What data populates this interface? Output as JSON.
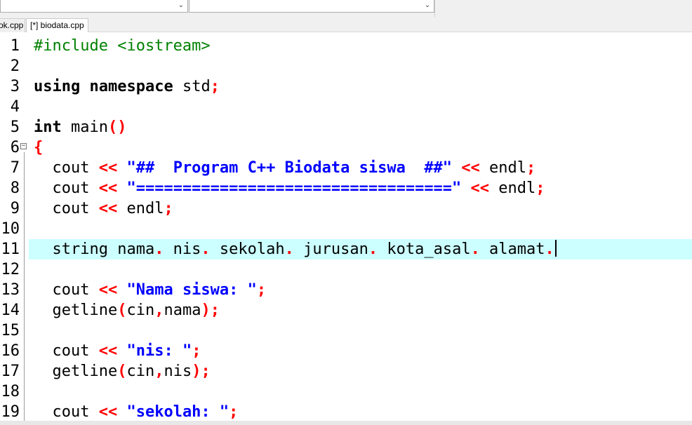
{
  "toolbar": {
    "combo1_value": "",
    "combo2_value": "",
    "dropdown_glyph": "⌄"
  },
  "tabs": [
    {
      "label": "ok.cpp",
      "active": false
    },
    {
      "label": "[*] biodata.cpp",
      "active": true
    }
  ],
  "editor": {
    "current_line": 11,
    "fold_glyph": "−",
    "colors": {
      "current_line_bg": "#ccffff",
      "preprocessor": "#008000",
      "string": "#0000ff",
      "symbol": "#ff0000",
      "keyword": "#000000"
    },
    "lines": [
      {
        "n": "1",
        "tokens": [
          {
            "t": "#include <iostream>",
            "c": "pre"
          }
        ]
      },
      {
        "n": "2",
        "tokens": []
      },
      {
        "n": "3",
        "tokens": [
          {
            "t": "using",
            "c": "kw"
          },
          {
            "t": " "
          },
          {
            "t": "namespace",
            "c": "kw"
          },
          {
            "t": " std"
          },
          {
            "t": ";",
            "c": "sym"
          }
        ]
      },
      {
        "n": "4",
        "tokens": []
      },
      {
        "n": "5",
        "tokens": [
          {
            "t": "int",
            "c": "kw"
          },
          {
            "t": " main"
          },
          {
            "t": "()",
            "c": "sym"
          }
        ]
      },
      {
        "n": "6",
        "tokens": [
          {
            "t": "{",
            "c": "sym"
          }
        ]
      },
      {
        "n": "7",
        "tokens": [
          {
            "t": "  cout "
          },
          {
            "t": "<<",
            "c": "sym"
          },
          {
            "t": " "
          },
          {
            "t": "\"##  Program C++ Biodata siswa  ##\"",
            "c": "str"
          },
          {
            "t": " "
          },
          {
            "t": "<<",
            "c": "sym"
          },
          {
            "t": " endl"
          },
          {
            "t": ";",
            "c": "sym"
          }
        ]
      },
      {
        "n": "8",
        "tokens": [
          {
            "t": "  cout "
          },
          {
            "t": "<<",
            "c": "sym"
          },
          {
            "t": " "
          },
          {
            "t": "\"==================================\"",
            "c": "str"
          },
          {
            "t": " "
          },
          {
            "t": "<<",
            "c": "sym"
          },
          {
            "t": " endl"
          },
          {
            "t": ";",
            "c": "sym"
          }
        ]
      },
      {
        "n": "9",
        "tokens": [
          {
            "t": "  cout "
          },
          {
            "t": "<<",
            "c": "sym"
          },
          {
            "t": " endl"
          },
          {
            "t": ";",
            "c": "sym"
          }
        ]
      },
      {
        "n": "10",
        "tokens": []
      },
      {
        "n": "11",
        "tokens": [
          {
            "t": "  string nama"
          },
          {
            "t": ".",
            "c": "sym"
          },
          {
            "t": " nis"
          },
          {
            "t": ".",
            "c": "sym"
          },
          {
            "t": " sekolah"
          },
          {
            "t": ".",
            "c": "sym"
          },
          {
            "t": " jurusan"
          },
          {
            "t": ".",
            "c": "sym"
          },
          {
            "t": " kota_asal"
          },
          {
            "t": ".",
            "c": "sym"
          },
          {
            "t": " alamat"
          },
          {
            "t": ".",
            "c": "sym"
          }
        ]
      },
      {
        "n": "12",
        "tokens": []
      },
      {
        "n": "13",
        "tokens": [
          {
            "t": "  cout "
          },
          {
            "t": "<<",
            "c": "sym"
          },
          {
            "t": " "
          },
          {
            "t": "\"Nama siswa: \"",
            "c": "str"
          },
          {
            "t": ";",
            "c": "sym"
          }
        ]
      },
      {
        "n": "14",
        "tokens": [
          {
            "t": "  getline"
          },
          {
            "t": "(",
            "c": "sym"
          },
          {
            "t": "cin"
          },
          {
            "t": ",",
            "c": "sym"
          },
          {
            "t": "nama"
          },
          {
            "t": ");",
            "c": "sym"
          }
        ]
      },
      {
        "n": "15",
        "tokens": []
      },
      {
        "n": "16",
        "tokens": [
          {
            "t": "  cout "
          },
          {
            "t": "<<",
            "c": "sym"
          },
          {
            "t": " "
          },
          {
            "t": "\"nis: \"",
            "c": "str"
          },
          {
            "t": ";",
            "c": "sym"
          }
        ]
      },
      {
        "n": "17",
        "tokens": [
          {
            "t": "  getline"
          },
          {
            "t": "(",
            "c": "sym"
          },
          {
            "t": "cin"
          },
          {
            "t": ",",
            "c": "sym"
          },
          {
            "t": "nis"
          },
          {
            "t": ");",
            "c": "sym"
          }
        ]
      },
      {
        "n": "18",
        "tokens": []
      },
      {
        "n": "19",
        "tokens": [
          {
            "t": "  cout "
          },
          {
            "t": "<<",
            "c": "sym"
          },
          {
            "t": " "
          },
          {
            "t": "\"sekolah: \"",
            "c": "str"
          },
          {
            "t": ";",
            "c": "sym"
          }
        ]
      }
    ]
  }
}
